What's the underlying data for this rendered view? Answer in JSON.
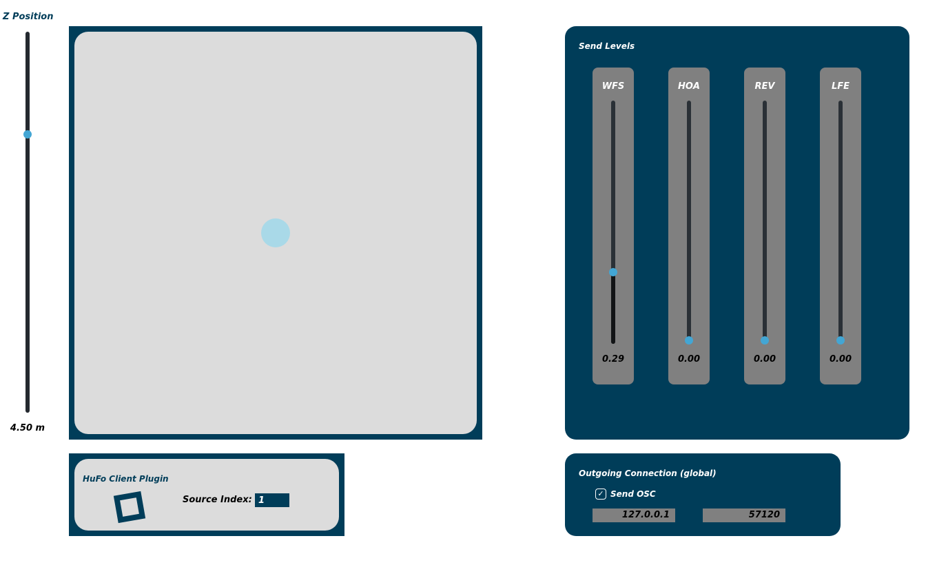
{
  "z_position": {
    "title": "Z Position",
    "value_label": "4.50 m",
    "level": 0.73
  },
  "xy_pad": {
    "source_x": 0.5,
    "source_y": 0.5
  },
  "plugin": {
    "title": "HuFo Client Plugin",
    "source_index_label": "Source Index:",
    "source_index_value": "1"
  },
  "send_levels": {
    "title": "Send Levels",
    "channels": [
      {
        "label": "WFS",
        "value": "0.29",
        "level": 0.29
      },
      {
        "label": "HOA",
        "value": "0.00",
        "level": 0.0
      },
      {
        "label": "REV",
        "value": "0.00",
        "level": 0.0
      },
      {
        "label": "LFE",
        "value": "0.00",
        "level": 0.0
      }
    ]
  },
  "connection": {
    "title": "Outgoing Connection (global)",
    "send_osc_label": "Send OSC",
    "send_osc_checked": true,
    "ip_address": "127.0.0.1",
    "port": "57120"
  },
  "colors": {
    "panel": "#003d59",
    "accent": "#43a6d4",
    "pad_bg": "#dcdcdc",
    "source": "#a9d9e8"
  }
}
